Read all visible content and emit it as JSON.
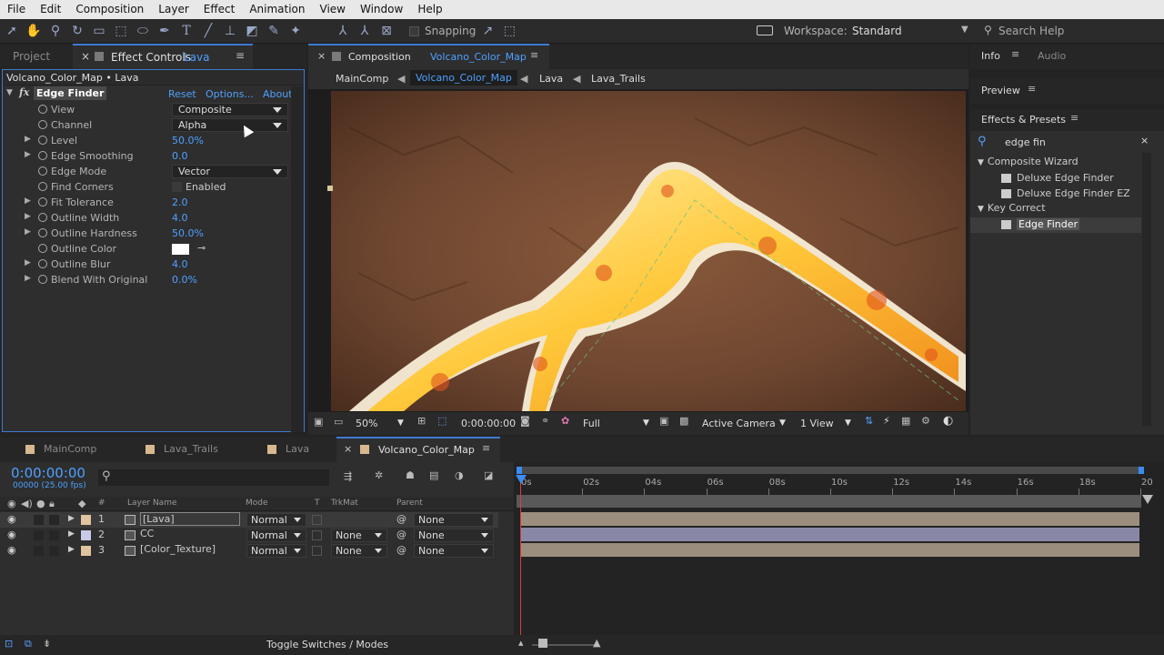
{
  "menu": [
    "File",
    "Edit",
    "Composition",
    "Layer",
    "Effect",
    "Animation",
    "View",
    "Window",
    "Help"
  ],
  "toolbar": {
    "snapping": "Snapping",
    "workspace_label": "Workspace:",
    "workspace_value": "Standard",
    "search": "Search Help"
  },
  "left_panel": {
    "tabs": [
      "Project",
      "Effect Controls"
    ],
    "effect_controls_layer": "Lava",
    "subheader": "Volcano_Color_Map • Lava",
    "effect_name": "Edge Finder",
    "reset": "Reset",
    "options": "Options...",
    "about": "About",
    "properties": [
      {
        "label": "View",
        "value": "Composite",
        "type": "dropdown",
        "expand": false
      },
      {
        "label": "Channel",
        "value": "Alpha",
        "type": "dropdown",
        "expand": false
      },
      {
        "label": "Level",
        "value": "50.0%",
        "type": "value",
        "expand": true
      },
      {
        "label": "Edge Smoothing",
        "value": "0.0",
        "type": "value",
        "expand": true
      },
      {
        "label": "Edge Mode",
        "value": "Vector",
        "type": "dropdown",
        "expand": false
      },
      {
        "label": "Find Corners",
        "value": "Enabled",
        "type": "checkbox",
        "expand": false
      },
      {
        "label": "Fit Tolerance",
        "value": "2.0",
        "type": "value",
        "expand": true
      },
      {
        "label": "Outline Width",
        "value": "4.0",
        "type": "value",
        "expand": true
      },
      {
        "label": "Outline Hardness",
        "value": "50.0%",
        "type": "value",
        "expand": true
      },
      {
        "label": "Outline Color",
        "value": "",
        "type": "color",
        "expand": false
      },
      {
        "label": "Outline Blur",
        "value": "4.0",
        "type": "value",
        "expand": true
      },
      {
        "label": "Blend With Original",
        "value": "0.0%",
        "type": "value",
        "expand": true
      }
    ]
  },
  "comp_panel": {
    "tab_prefix": "Composition",
    "tab_name": "Volcano_Color_Map",
    "breadcrumbs": [
      "MainComp",
      "Volcano_Color_Map",
      "Lava",
      "Lava_Trails"
    ],
    "zoom": "50%",
    "timecode": "0:00:00:00",
    "resolution": "Full",
    "camera": "Active Camera",
    "views": "1 View"
  },
  "right_panel": {
    "info_tab": "Info",
    "audio_tab": "Audio",
    "preview": "Preview",
    "effects_presets": "Effects & Presets",
    "search_value": "edge fin",
    "groups": [
      {
        "name": "Composite Wizard",
        "items": [
          "Deluxe Edge Finder",
          "Deluxe Edge Finder EZ"
        ]
      },
      {
        "name": "Key Correct",
        "items": [
          "Edge Finder"
        ]
      }
    ]
  },
  "timeline": {
    "tabs": [
      "MainComp",
      "Lava_Trails",
      "Lava",
      "Volcano_Color_Map"
    ],
    "timecode": "0:00:00:00",
    "frame_info": "00000 (25.00 fps)",
    "columns": {
      "layer_name": "Layer Name",
      "mode": "Mode",
      "t": "T",
      "trkmat": "TrkMat",
      "parent": "Parent"
    },
    "ruler": [
      "0s",
      "02s",
      "04s",
      "06s",
      "08s",
      "10s",
      "12s",
      "14s",
      "16s",
      "18s",
      "20"
    ],
    "layers": [
      {
        "num": "1",
        "name": "[Lava]",
        "mode": "Normal",
        "trkmat": "",
        "parent": "None",
        "color": "#e0c4a0",
        "bar": "#9c8e7e"
      },
      {
        "num": "2",
        "name": "CC",
        "mode": "Normal",
        "trkmat": "None",
        "parent": "None",
        "color": "#c9c9e8",
        "bar": "#8888a6"
      },
      {
        "num": "3",
        "name": "[Color_Texture]",
        "mode": "Normal",
        "trkmat": "None",
        "parent": "None",
        "color": "#e0c4a0",
        "bar": "#9c8e7e"
      }
    ],
    "toggle": "Toggle Switches / Modes"
  }
}
